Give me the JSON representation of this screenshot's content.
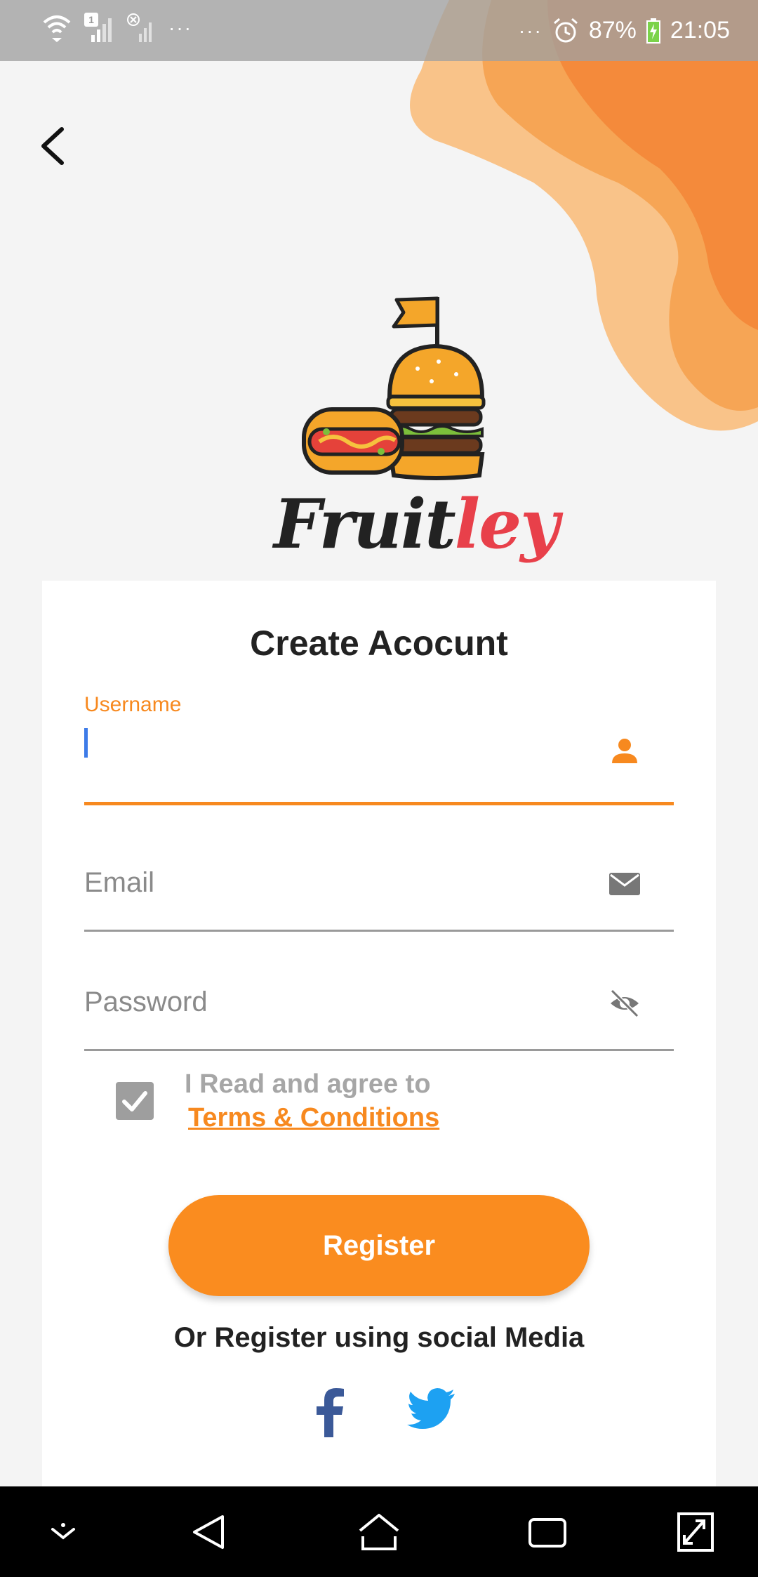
{
  "status_bar": {
    "sim1_badge": "1",
    "dots_left": "···",
    "dots_right": "···",
    "battery": "87%",
    "time": "21:05"
  },
  "header": {
    "back_icon": "back-arrow-icon"
  },
  "logo": {
    "icon": "burger-hotdog-logo",
    "brand_name": "Fruitley"
  },
  "form": {
    "title": "Create Acocunt",
    "username": {
      "label": "Username",
      "value": "",
      "icon": "person-icon"
    },
    "email": {
      "placeholder": "Email",
      "icon": "mail-icon"
    },
    "password": {
      "placeholder": "Password",
      "icon": "eye-off-icon"
    },
    "agree": {
      "checked": true,
      "text": "I Read  and agree to",
      "link": "Terms & Conditions"
    },
    "register_label": "Register",
    "social_text": "Or Register using social Media",
    "social_icons": [
      "facebook-icon",
      "twitter-icon"
    ]
  },
  "colors": {
    "accent": "#fa8c1f",
    "label_accent": "#f7891f",
    "caret": "#3d7be8",
    "facebook": "#3b5998",
    "twitter": "#1da1f2"
  }
}
